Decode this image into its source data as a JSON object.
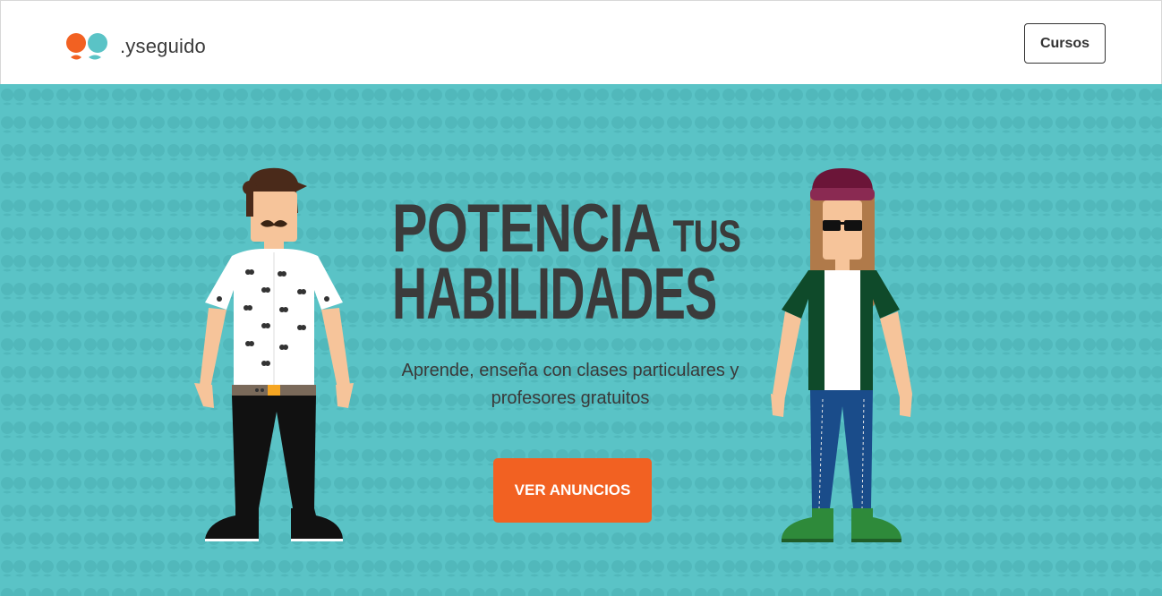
{
  "brand": {
    "name": ".yseguido",
    "colors": {
      "orange": "#f26122",
      "teal": "#5ac3c6"
    }
  },
  "nav": {
    "cursos_label": "Cursos"
  },
  "hero": {
    "headline_part1": "POTENCIA",
    "headline_part1_small": "TUS",
    "headline_part2": "HABILIDADES",
    "subtitle": "Aprende, enseña con clases particulares y profesores gratuitos",
    "cta_label": "VER ANUNCIOS",
    "background_color": "#5ac3c6"
  },
  "illustrations": {
    "left": "man-with-mustache-illustration",
    "right": "woman-with-beanie-illustration"
  }
}
